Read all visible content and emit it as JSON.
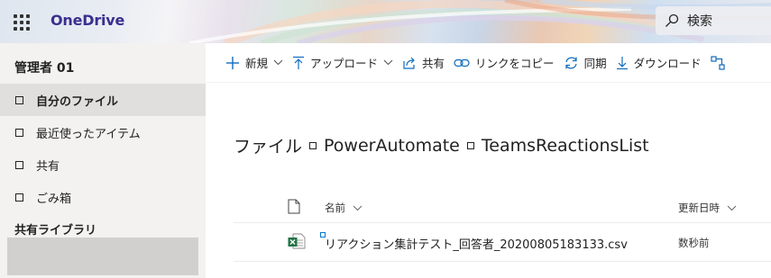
{
  "header": {
    "app_launcher_icon": "waffle-icon",
    "brand": "OneDrive",
    "search": {
      "icon": "search-icon",
      "label": "検索"
    }
  },
  "sidebar": {
    "user_name": "管理者 01",
    "items": [
      {
        "label": "自分のファイル",
        "active": true
      },
      {
        "label": "最近使ったアイテム",
        "active": false
      },
      {
        "label": "共有",
        "active": false
      },
      {
        "label": "ごみ箱",
        "active": false
      }
    ],
    "section_label": "共有ライブラリ"
  },
  "command_bar": {
    "new": {
      "label": "新規",
      "icon": "plus-icon"
    },
    "upload": {
      "label": "アップロード",
      "icon": "upload-icon"
    },
    "share": {
      "label": "共有",
      "icon": "share-icon"
    },
    "copy_link": {
      "label": "リンクをコピー",
      "icon": "link-icon"
    },
    "sync": {
      "label": "同期",
      "icon": "sync-icon"
    },
    "download": {
      "label": "ダウンロード",
      "icon": "download-icon"
    }
  },
  "breadcrumb": {
    "root": "ファイル",
    "level1": "PowerAutomate",
    "level2": "TeamsReactionsList"
  },
  "file_list": {
    "columns": {
      "name": "名前",
      "modified": "更新日時"
    },
    "rows": [
      {
        "name": "リアクション集計テスト_回答者_20200805183133.csv",
        "modified": "数秒前",
        "icon": "excel-csv-icon"
      }
    ]
  },
  "colors": {
    "brand": "#3a2f8f",
    "accent": "#0078d4",
    "sidebar_bg": "#f3f2f1",
    "sidebar_active": "#e1dfdd",
    "excel_green": "#217346"
  }
}
